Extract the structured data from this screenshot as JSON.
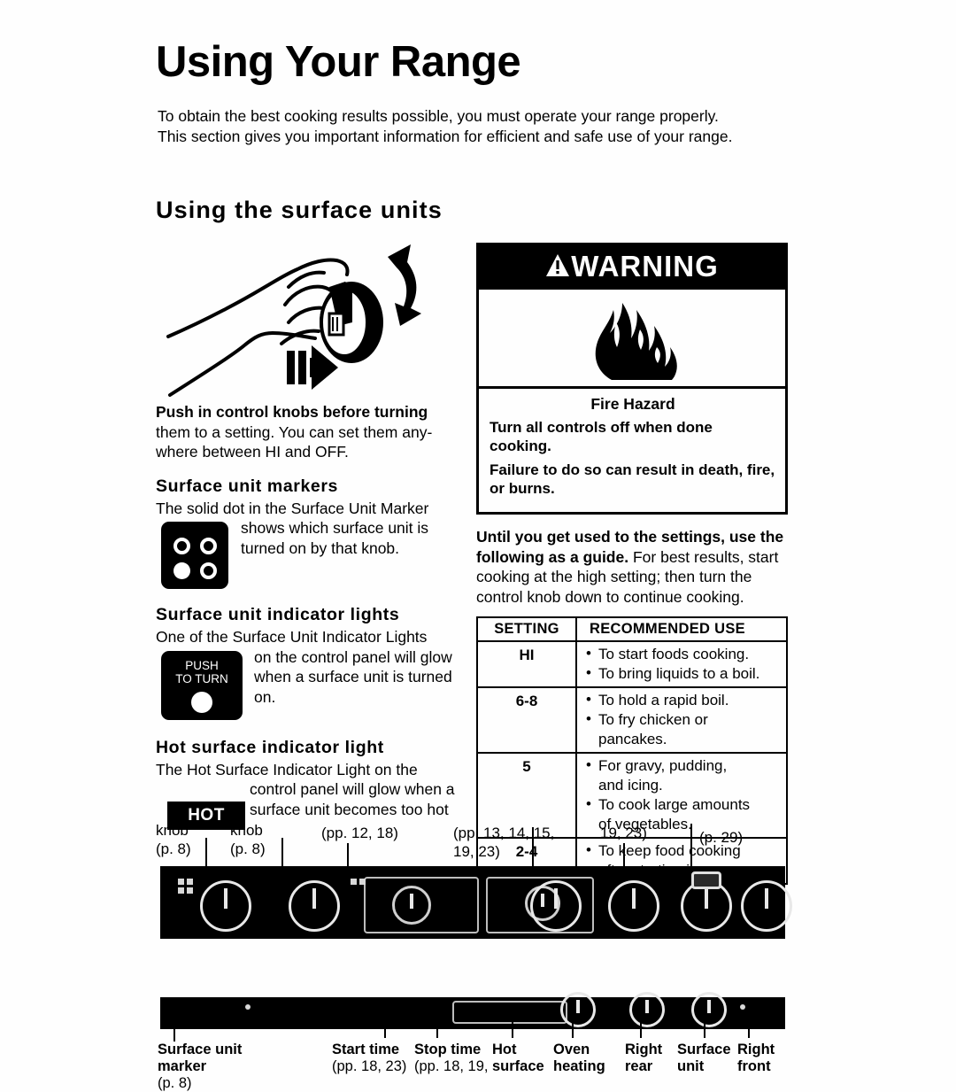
{
  "page": {
    "title": "Using Your Range",
    "intro": "To obtain the best cooking results possible, you must operate your range properly. This section gives you important information for efficient and safe use of your range.",
    "section_heading": "Using the surface units"
  },
  "left_column": {
    "push_knobs": {
      "bold_lead": "Push in control knobs before turning",
      "rest": " them to a setting. You can set them any-where between HI and OFF."
    },
    "surface_unit_markers": {
      "heading": "Surface unit markers",
      "text_line1": "The solid dot in the Surface Unit Marker",
      "text_rest": "shows which surface unit is turned on by that knob."
    },
    "indicator_lights": {
      "heading": "Surface unit indicator lights",
      "text_line1": "One of the Surface Unit Indicator Lights",
      "text_rest": "on the control panel will glow when a surface unit is turned on.",
      "knob_label_line1": "PUSH",
      "knob_label_line2": "TO TURN"
    },
    "hot_surface": {
      "heading": "Hot surface indicator light",
      "text_line1": "The Hot Surface Indicator Light on the",
      "text_rest": "control panel will glow when a surface unit becomes too hot",
      "badge": "HOT"
    }
  },
  "warning": {
    "header": "WARNING",
    "icon": "warning-triangle-icon",
    "pictogram": "flame-icon",
    "title": "Fire Hazard",
    "line1": "Turn all controls off when done cooking.",
    "line2": "Failure to do so can result in death, fire, or burns."
  },
  "guide": {
    "bold_lead": "Until you get used to the settings, use the following as a guide.",
    "rest": " For best results, start cooking at the high setting; then turn the control knob down to continue cooking."
  },
  "settings_table": {
    "headers": [
      "SETTING",
      "RECOMMENDED USE"
    ],
    "rows": [
      {
        "setting": "HI",
        "uses": [
          {
            "text": "To start foods cooking.",
            "cont": ""
          },
          {
            "text": "To bring liquids to a boil.",
            "cont": ""
          }
        ]
      },
      {
        "setting": "6-8",
        "uses": [
          {
            "text": "To hold a rapid boil.",
            "cont": ""
          },
          {
            "text": "To fry chicken or",
            "cont": "pancakes."
          }
        ]
      },
      {
        "setting": "5",
        "uses": [
          {
            "text": "For gravy, pudding,",
            "cont": "and icing."
          },
          {
            "text": "To cook large amounts",
            "cont": "of vegetables."
          }
        ]
      },
      {
        "setting": "2-4",
        "uses": [
          {
            "text": "To keep food cooking",
            "cont": "after starting it on a"
          }
        ]
      }
    ]
  },
  "panel_callouts_top": [
    {
      "line1": "knob",
      "line2": "(p. 8)"
    },
    {
      "line1": "knob",
      "line2": "(p. 8)"
    },
    {
      "line1": "(pp. 12, 18)",
      "line2": ""
    },
    {
      "line1": "(pp. 13, 14, 15,",
      "line2": "19, 23)"
    },
    {
      "line1": "19, 23)",
      "line2": ""
    },
    {
      "line1": "(p. 29)",
      "line2": ""
    }
  ],
  "panel_callouts_bottom": [
    {
      "name": "Surface unit marker",
      "ref": "(p. 8)"
    },
    {
      "name": "Start time",
      "ref": "(pp. 18, 23)"
    },
    {
      "name": "Stop time",
      "ref": "(pp. 18, 19,"
    },
    {
      "name": "Hot surface",
      "ref": ""
    },
    {
      "name": "Oven heating",
      "ref": ""
    },
    {
      "name": "Right rear",
      "ref": ""
    },
    {
      "name": "Surface unit",
      "ref": ""
    },
    {
      "name": "Right front",
      "ref": ""
    }
  ]
}
